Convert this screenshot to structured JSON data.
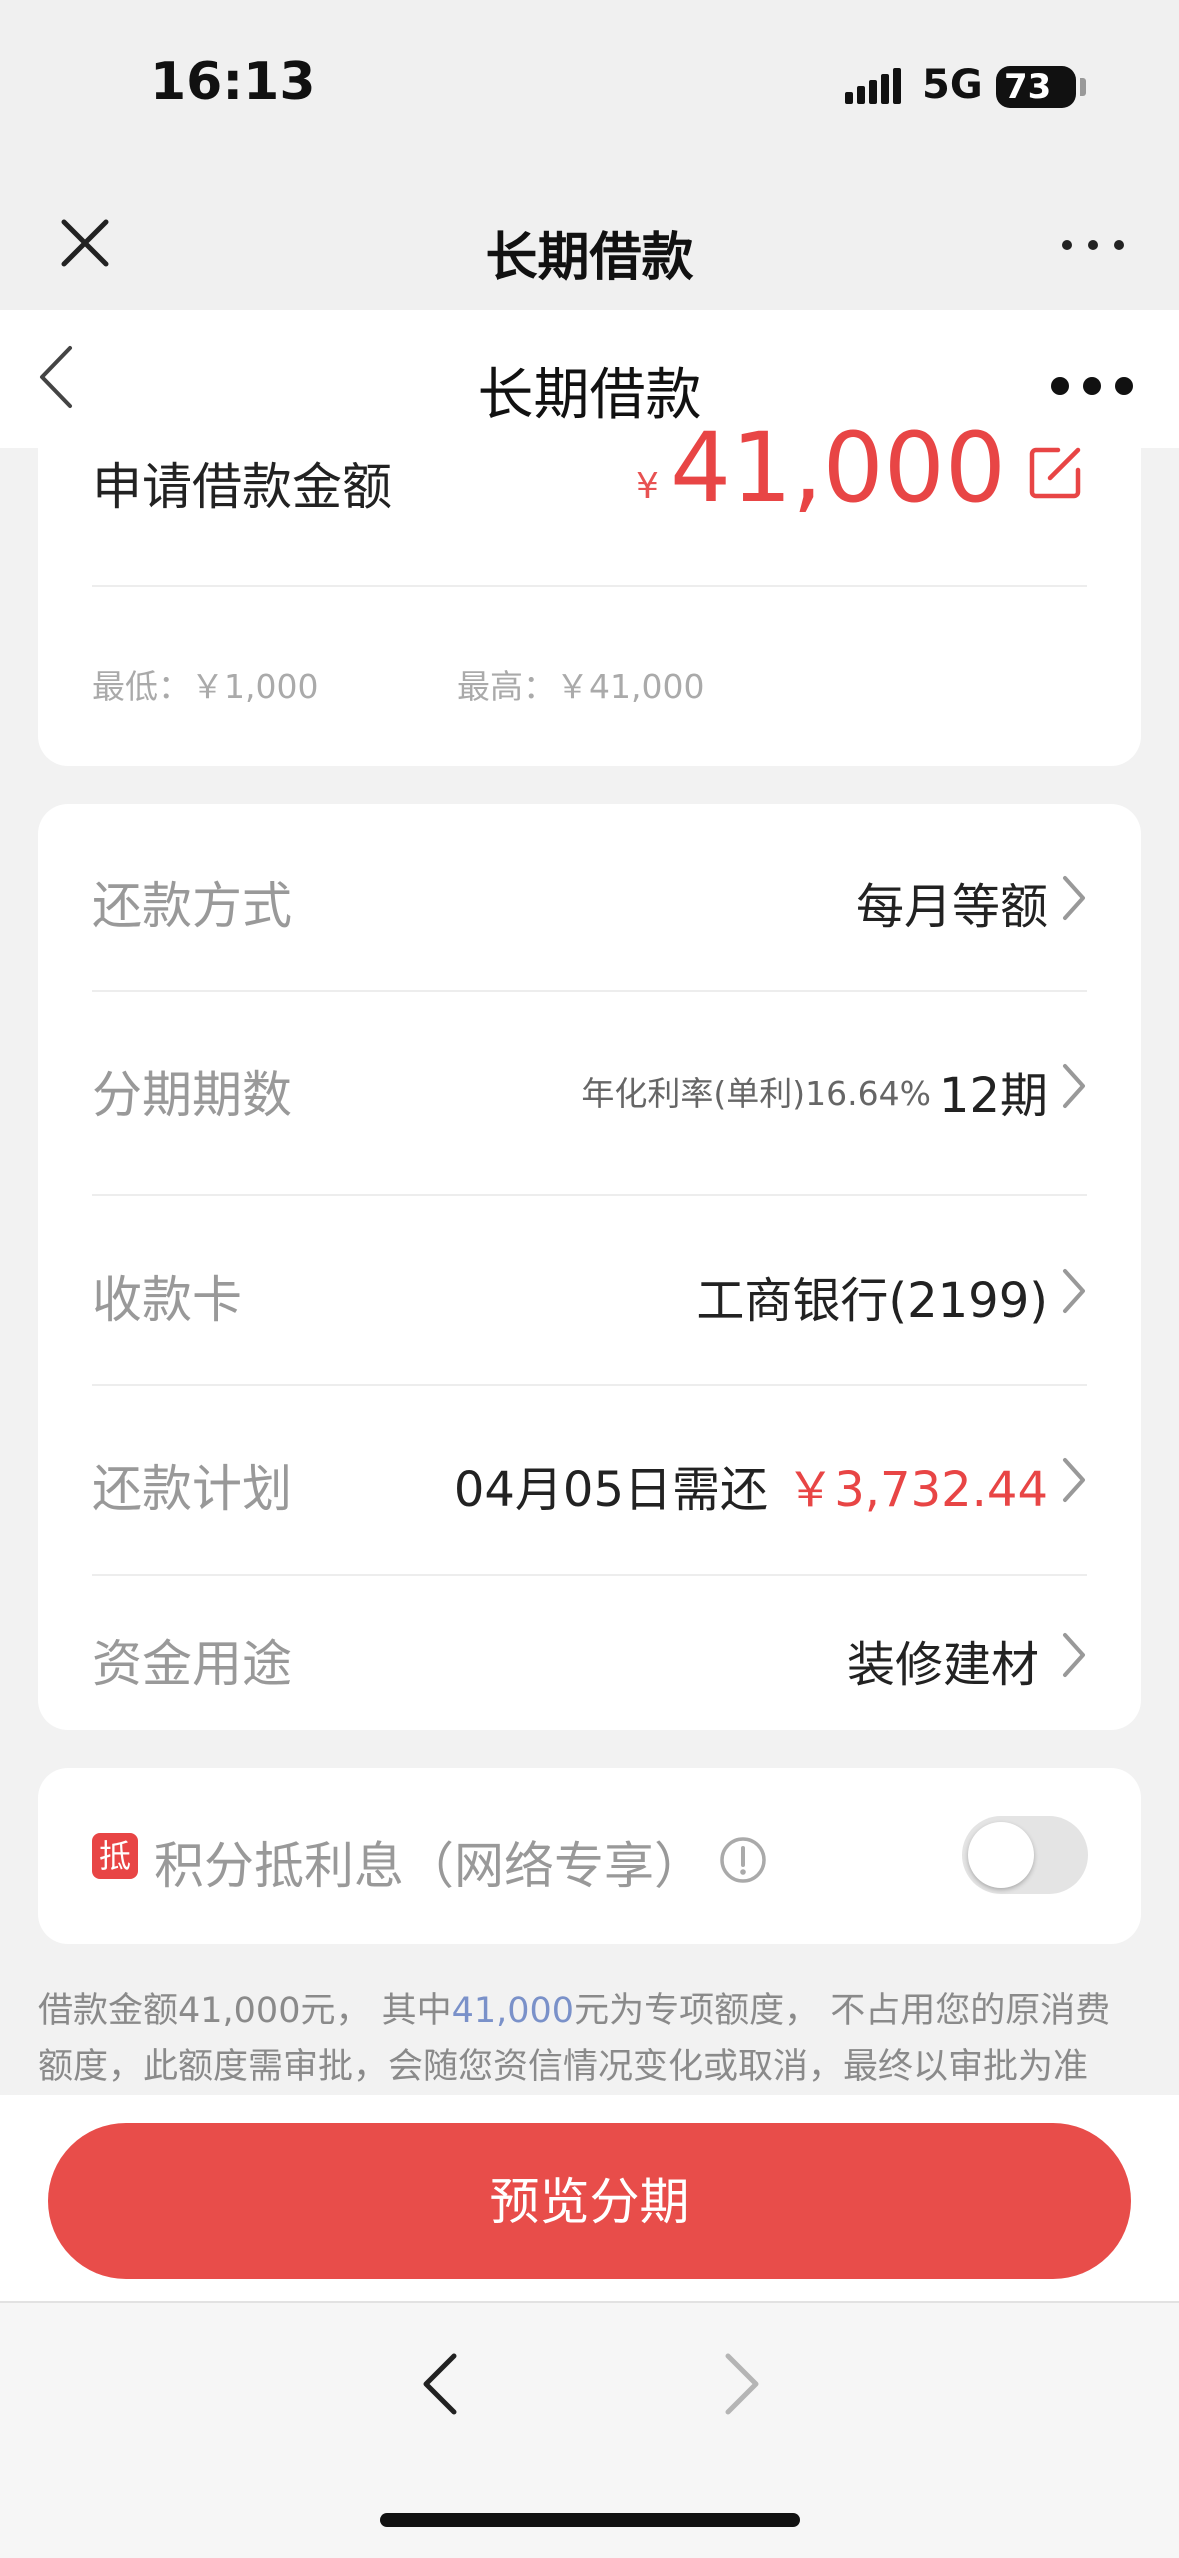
{
  "status": {
    "time": "16:13",
    "network": "5G",
    "battery": "73"
  },
  "outer_nav": {
    "title": "长期借款"
  },
  "inner_nav": {
    "title": "长期借款"
  },
  "amount": {
    "label": "申请借款金额",
    "currency": "¥",
    "value": "41,000",
    "min": "最低：￥1,000",
    "max": "最高：￥41,000"
  },
  "details": {
    "repay_method": {
      "label": "还款方式",
      "value": "每月等额"
    },
    "installments": {
      "label": "分期期数",
      "rate": "年化利率(单利)16.64%",
      "value": "12期"
    },
    "card": {
      "label": "收款卡",
      "value": "工商银行(2199)"
    },
    "plan": {
      "label": "还款计划",
      "date": "04月05日需还",
      "amount": "￥3,732.44"
    },
    "purpose": {
      "label": "资金用途",
      "value": "装修建材"
    }
  },
  "points": {
    "badge": "抵",
    "label": "积分抵利息（网络专享）",
    "enabled": false
  },
  "notice": {
    "part1": "借款金额41,000元， 其中",
    "highlight": "41,000",
    "part2": "元为专项额度， 不占用您的原消费额度，此额度需审批，会随您资信情况变化或取消，最终以审批为准"
  },
  "actions": {
    "preview": "预览分期"
  },
  "colors": {
    "accent": "#e84545",
    "link": "#7a91c9"
  },
  "icons": [
    "close-icon",
    "more-icon",
    "back-icon",
    "edit-icon",
    "chevron-right-icon",
    "info-icon",
    "browser-back-icon",
    "browser-forward-icon"
  ]
}
